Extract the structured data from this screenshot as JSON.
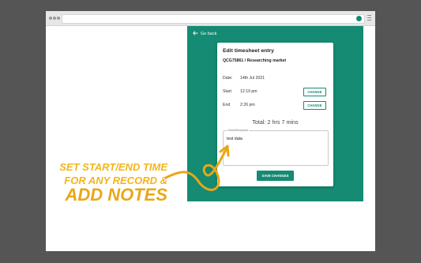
{
  "browser": {
    "ext_icon": "app-extension-icon",
    "menu_icon": "menu-icon"
  },
  "panel": {
    "back_label": "Go back",
    "accent_color": "#148b72"
  },
  "card": {
    "title": "Edit timesheet entry",
    "subtitle": "QCG75861 / Researching market",
    "date": {
      "label": "Date:",
      "value": "14th Jul 2021"
    },
    "start": {
      "label": "Start",
      "value": "12:19 pm",
      "button": "CHANGE"
    },
    "end": {
      "label": "End",
      "value": "2:26 pm",
      "button": "CHANGE"
    },
    "total": "Total: 2 hrs 7 mins",
    "notes": {
      "label": "Notes/Description",
      "value": "test data"
    },
    "save_label": "SAVE CHANGES"
  },
  "promo": {
    "line1": "SET START/END TIME",
    "line2": "FOR ANY RECORD &",
    "line3": "ADD NOTES",
    "color": "#f3b51a"
  }
}
